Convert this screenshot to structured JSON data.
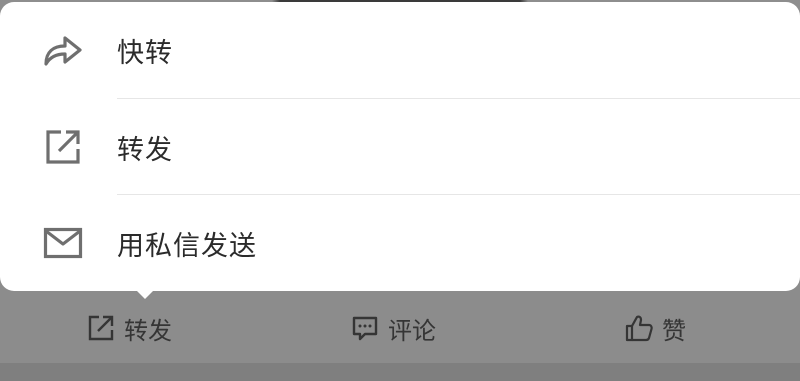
{
  "menu": {
    "items": [
      {
        "label": "快转",
        "icon": "share-arrow-icon"
      },
      {
        "label": "转发",
        "icon": "external-share-icon"
      },
      {
        "label": "用私信发送",
        "icon": "envelope-icon"
      }
    ]
  },
  "action_bar": {
    "repost": {
      "label": "转发",
      "icon": "external-share-icon"
    },
    "comment": {
      "label": "评论",
      "icon": "comment-icon"
    },
    "like": {
      "label": "赞",
      "icon": "thumbs-up-icon"
    }
  },
  "colors": {
    "popup_bg": "#ffffff",
    "overlay_bg": "#8c8c8c",
    "icon": "#6f6f6f",
    "text": "#2b2b2b"
  }
}
